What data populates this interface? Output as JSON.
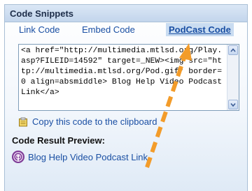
{
  "panel": {
    "title": "Code Snippets"
  },
  "tabs": [
    {
      "label": "Link Code",
      "active": false
    },
    {
      "label": "Embed Code",
      "active": false
    },
    {
      "label": "PodCast Code",
      "active": true
    }
  ],
  "code_box": {
    "value": "<a href=\"http://multimedia.mtlsd.org/Play.asp?FILEID=14592\" target=_NEW><img src=\"http://multimedia.mtlsd.org/Pod.gif\" border=0 align=absmiddle> Blog Help Video Podcast Link</a>"
  },
  "copy_link": {
    "label": "Copy this code to the clipboard",
    "icon": "clipboard-icon"
  },
  "preview": {
    "label": "Code Result Preview:",
    "link_text": "Blog Help Video Podcast Link",
    "icon": "podcast-icon"
  },
  "annotation": {
    "type": "dashed-arrow",
    "color": "#f39c2a"
  },
  "colors": {
    "title_bar": "#c3d5ec",
    "link": "#1a4fa3",
    "active_tab_bg": "#c9dcf1",
    "border": "#a9bfd6"
  }
}
